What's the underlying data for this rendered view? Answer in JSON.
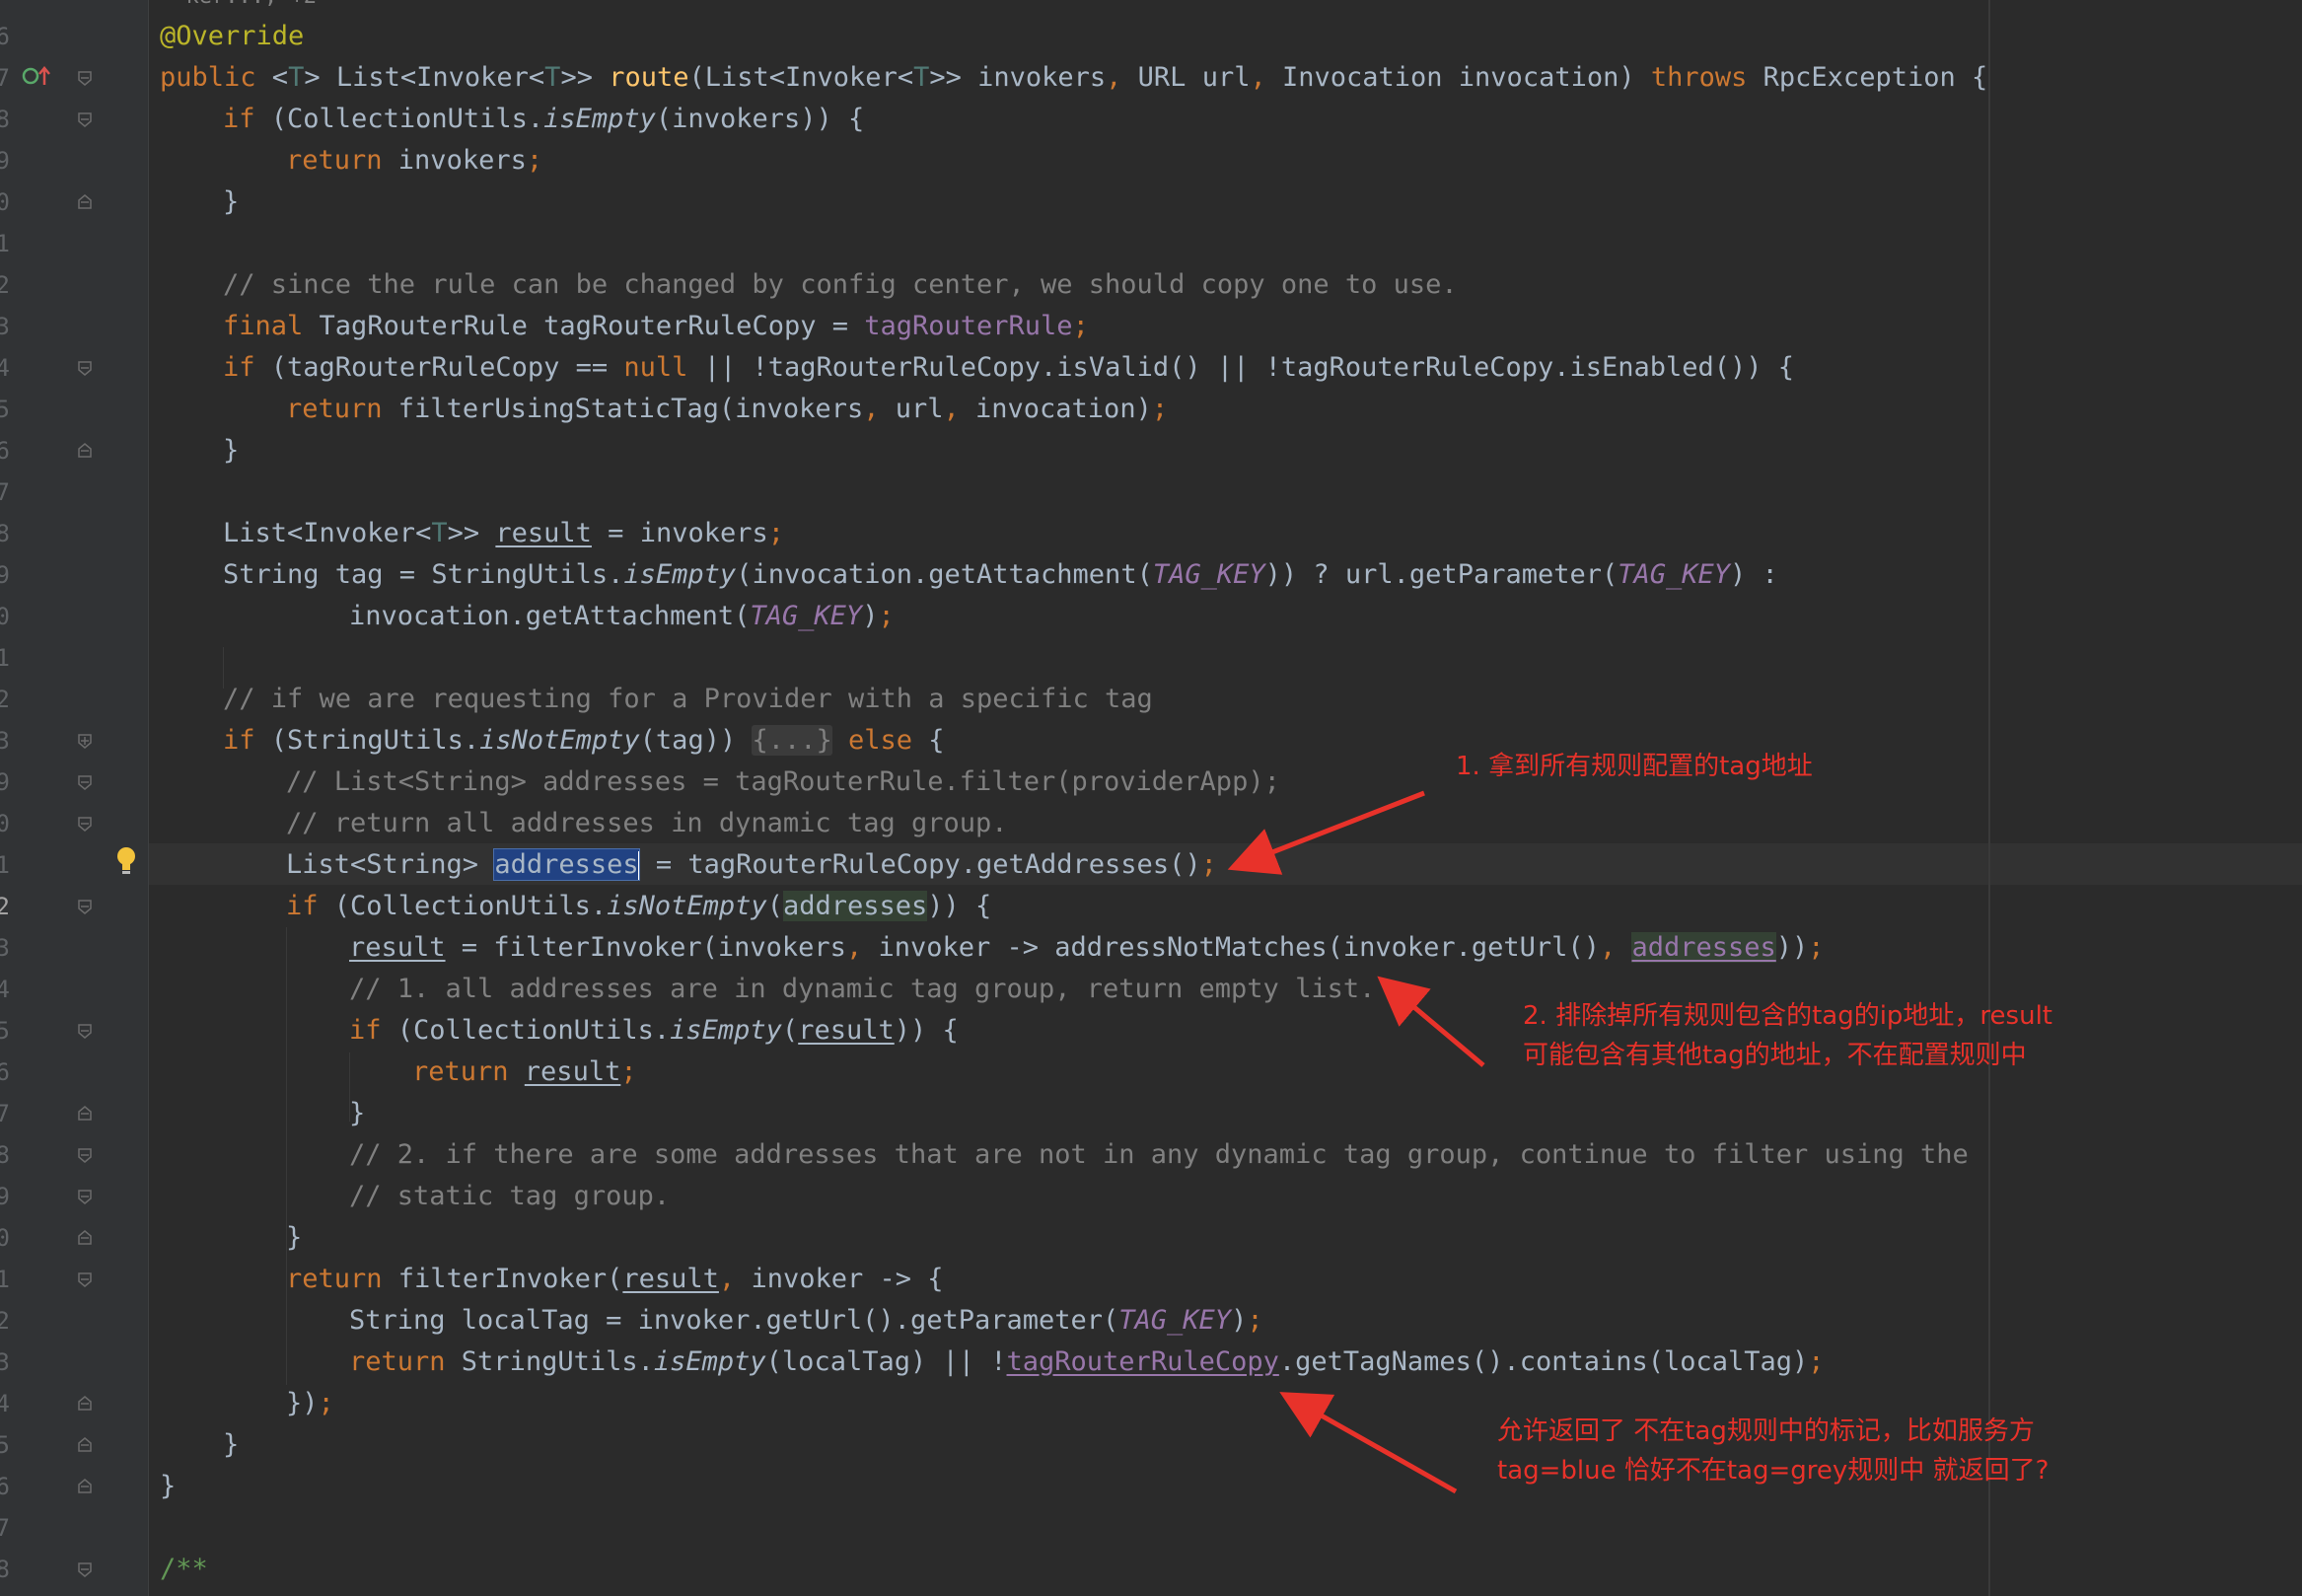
{
  "line_numbers": [
    "6",
    "7",
    "8",
    "9",
    "0",
    "1",
    "2",
    "3",
    "4",
    "5",
    "6",
    "7",
    "8",
    "9",
    "0",
    "1",
    "2",
    "3",
    "9",
    "0",
    "1",
    "2",
    "3",
    "4",
    "5",
    "6",
    "7",
    "8",
    "9",
    "0",
    "1",
    "2",
    "3",
    "4",
    "5",
    "6",
    "7",
    "8"
  ],
  "current_line_index": 21,
  "partial_top_text": "— ker..., +2",
  "code": {
    "l0": "@Override",
    "l1": {
      "a": "public ",
      "b": "<",
      "c": "T",
      "d": "> List<Invoker<",
      "e": "T",
      "f": ">> ",
      "g": "route",
      "h": "(List<Invoker<",
      "i": "T",
      "j": ">> invokers",
      "k": ", ",
      "l": "URL url",
      "m": ", ",
      "n": "Invocation invocation) ",
      "o": "throws ",
      "p": "RpcException {"
    },
    "l2": {
      "a": "if ",
      "b": "(CollectionUtils.",
      "c": "isEmpty",
      "d": "(invokers)) {"
    },
    "l3": {
      "a": "return ",
      "b": "invokers",
      "c": ";"
    },
    "l4": "}",
    "l6": "// since the rule can be changed by config center, we should copy one to use.",
    "l7": {
      "a": "final ",
      "b": "TagRouterRule tagRouterRuleCopy = ",
      "c": "tagRouterRule",
      "d": ";"
    },
    "l8": {
      "a": "if ",
      "b": "(tagRouterRuleCopy == ",
      "c": "null ",
      "d": "|| !tagRouterRuleCopy.isValid() || !tagRouterRuleCopy.isEnabled()) {"
    },
    "l9": {
      "a": "return ",
      "b": "filterUsingStaticTag(invokers",
      "c": ", ",
      "d": "url",
      "e": ", ",
      "f": "invocation)",
      "g": ";"
    },
    "l10": "}",
    "l12": {
      "a": "List<Invoker<",
      "b": "T",
      "c": ">> ",
      "d": "result",
      "e": " = invokers",
      "f": ";"
    },
    "l13": {
      "a": "String tag = StringUtils.",
      "b": "isEmpty",
      "c": "(invocation.getAttachment(",
      "d": "TAG_KEY",
      "e": ")) ? url.getParameter(",
      "f": "TAG_KEY",
      "g": ") :"
    },
    "l14": {
      "a": "invocation.getAttachment(",
      "b": "TAG_KEY",
      "c": ")",
      "d": ";"
    },
    "l16": "// if we are requesting for a Provider with a specific tag",
    "l17": {
      "a": "if ",
      "b": "(StringUtils.",
      "c": "isNotEmpty",
      "d": "(tag)) ",
      "e": "{...}",
      "f": " ",
      "g": "else ",
      "h": "{"
    },
    "l18": "// List<String> addresses = tagRouterRule.filter(providerApp);",
    "l19": "// return all addresses in dynamic tag group.",
    "l20": {
      "a": "List<String> ",
      "b": "addresses",
      "c": " = tagRouterRuleCopy.getAddresses()",
      "d": ";"
    },
    "l21": {
      "a": "if ",
      "b": "(CollectionUtils.",
      "c": "isNotEmpty",
      "d": "(",
      "e": "addresses",
      "f": ")) {"
    },
    "l22": {
      "a": "result",
      "b": " = filterInvoker(invokers",
      "c": ", ",
      "d": "invoker -> addressNotMatches(invoker.getUrl()",
      "e": ", ",
      "f": "addresses",
      "g": "))",
      "h": ";"
    },
    "l23": "// 1. all addresses are in dynamic tag group, return empty list.",
    "l24": {
      "a": "if ",
      "b": "(CollectionUtils.",
      "c": "isEmpty",
      "d": "(",
      "e": "result",
      "f": ")) {"
    },
    "l25": {
      "a": "return ",
      "b": "result",
      "c": ";"
    },
    "l26": "}",
    "l27": "// 2. if there are some addresses that are not in any dynamic tag group, continue to filter using the",
    "l28": "// static tag group.",
    "l29": "}",
    "l30": {
      "a": "return ",
      "b": "filterInvoker(",
      "c": "result",
      "d": ", ",
      "e": "invoker -> {"
    },
    "l31": {
      "a": "String localTag = invoker.getUrl().getParameter(",
      "b": "TAG_KEY",
      "c": ")",
      "d": ";"
    },
    "l32": {
      "a": "return ",
      "b": "StringUtils.",
      "c": "isEmpty",
      "d": "(localTag) || !",
      "e": "tagRouterRuleCopy",
      "f": ".getTagNames().contains(localTag)",
      "g": ";"
    },
    "l33": {
      "a": "})",
      "b": ";"
    },
    "l34": "}",
    "l35": "}",
    "l37": "/**"
  },
  "annotations": {
    "note1": "1. 拿到所有规则配置的tag地址",
    "note2_line1": "2. 排除掉所有规则包含的tag的ip地址，result",
    "note2_line2": "可能包含有其他tag的地址，不在配置规则中",
    "note3_line1": "允许返回了 不在tag规则中的标记，比如服务方",
    "note3_line2": "tag=blue 恰好不在tag=grey规则中 就返回了?"
  },
  "colors": {
    "background": "#2b2b2b",
    "gutter": "#313335",
    "keyword": "#cc7832",
    "annotation_text": "#e8322a",
    "selection": "#214283"
  },
  "icons": {
    "override": "override-method-icon",
    "bulb": "intention-bulb-icon",
    "fold": "fold-marker-icon"
  }
}
